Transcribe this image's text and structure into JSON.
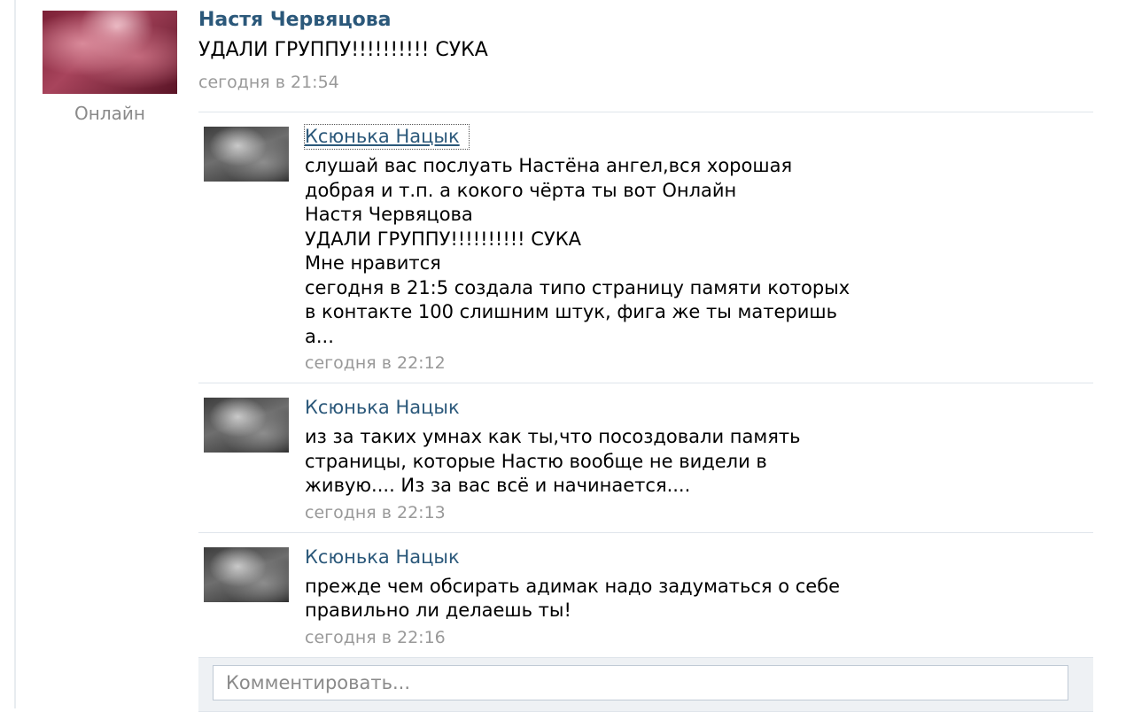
{
  "post": {
    "author": "Настя Червяцова",
    "status": "Онлайн",
    "text": "УДАЛИ ГРУППУ!!!!!!!!!! СУКА",
    "time": "сегодня в 21:54"
  },
  "comments": [
    {
      "author": "Ксюнька Нацык",
      "text": "слушай вас послуать Настёна ангел,вся хорошая\nдобрая и т.п. а кокого чёрта ты вот Онлайн\nНастя Червяцова\nУДАЛИ ГРУППУ!!!!!!!!!! СУКА\nМне нравится\nсегодня в 21:5 создала типо страницу памяти которых\nв контакте 100 слишним штук, фига же ты материшь\nа...",
      "time": "сегодня в 22:12"
    },
    {
      "author": "Ксюнька Нацык",
      "text": "из за таких умнах как ты,что посоздовали память\nстраницы, которые Настю вообще не видели в\nживую.... Из за вас всё и начинается....",
      "time": "сегодня в 22:13"
    },
    {
      "author": "Ксюнька Нацык",
      "text": "прежде чем обсирать адимак надо задуматься о себе\nправильно ли делаешь ты!",
      "time": "сегодня в 22:16"
    }
  ],
  "reply": {
    "placeholder": "Комментировать..."
  }
}
